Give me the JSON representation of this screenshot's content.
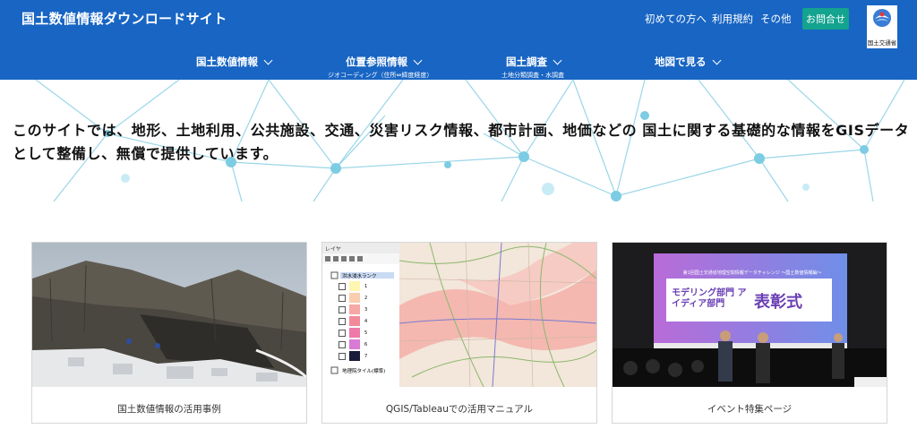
{
  "header": {
    "site_title": "国土数値情報ダウンロードサイト",
    "top_links": [
      "初めての方へ",
      "利用規約",
      "その他"
    ],
    "contact_label": "お問合せ",
    "logo_text": "国土交通省",
    "nav": [
      {
        "label": "国土数値情報",
        "sub": ""
      },
      {
        "label": "位置参照情報",
        "sub": "ジオコーディング（住所⇔緯度経度）"
      },
      {
        "label": "国土調査",
        "sub": "土地分類調査・水調査"
      },
      {
        "label": "地図で見る",
        "sub": ""
      }
    ]
  },
  "hero": {
    "line1": "このサイトでは、地形、土地利用、公共施設、交通、災害リスク情報、都市計画、地価などの 国土に関する基礎的な情報をGISデータ",
    "line2": "として整備し、無償で提供しています。"
  },
  "cards": [
    {
      "caption": "国土数値情報の活用事例"
    },
    {
      "caption": "QGIS/Tableauでの活用マニュアル"
    },
    {
      "caption": "イベント特集ページ"
    }
  ],
  "qgis": {
    "panel_title": "レイヤ",
    "layer1": "洪水浸水ランク",
    "classes": [
      "1",
      "2",
      "3",
      "4",
      "5",
      "6",
      "7"
    ],
    "layer2": "地理院タイル(標準)"
  },
  "event": {
    "banner_small": "第1回国土交通省地理空間情報データチャレンジ ～国土数値情報編～",
    "banner_main": "モデリング部門 アイディア部門",
    "banner_big": "表彰式"
  },
  "colors": {
    "header_bg": "#1865c4",
    "contact_bg": "#13a38f",
    "network": "#8fd3e6"
  }
}
